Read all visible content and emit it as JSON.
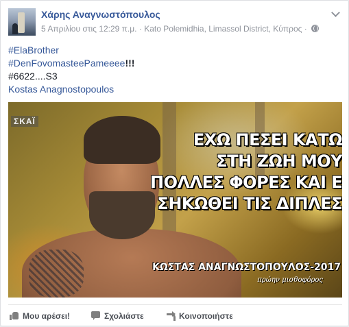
{
  "post": {
    "author": "Χάρης Αναγνωστόπουλος",
    "date": "5 Απριλίου στις 12:29 π.μ.",
    "separator": "·",
    "location": "Kato Polemidhia, Limassol District, Κύπρος",
    "privacy_icon": "globe-icon",
    "menu_icon": "chevron-down-icon",
    "lines": {
      "hashtag1": "#ElaBrother",
      "hashtag2": "#DenFovomasteePameeee",
      "exclaim": "!!!",
      "tag3_link": "#6622",
      "tag3_rest": "....S3",
      "mention": "Kostas Anagnostopoulos"
    }
  },
  "media": {
    "channel_logo": "ΣΚΑΪ",
    "quote": {
      "line1": "ΕΧΩ ΠΕΣΕΙ ΚΑΤΩ",
      "line2": "ΣΤΗ ΖΩΗ ΜΟΥ",
      "line3": "ΠΟΛΛΕΣ ΦΟΡΕΣ ΚΑΙ ΕΧΩ",
      "line4": "ΣΗΚΩΘΕΙ ΤΙΣ ΔΙΠΛΕΣ"
    },
    "caption_name": "ΚΩΣΤΑΣ ΑΝΑΓΝΩΣΤΟΠΟΥΛΟΣ-2017",
    "caption_sub": "πρώην μισθοφόρος"
  },
  "actions": {
    "like": {
      "label": "Μου αρέσει!",
      "icon": "like-icon"
    },
    "comment": {
      "label": "Σχολιάστε",
      "icon": "comment-icon"
    },
    "share": {
      "label": "Κοινοποιήστε",
      "icon": "share-icon"
    }
  }
}
